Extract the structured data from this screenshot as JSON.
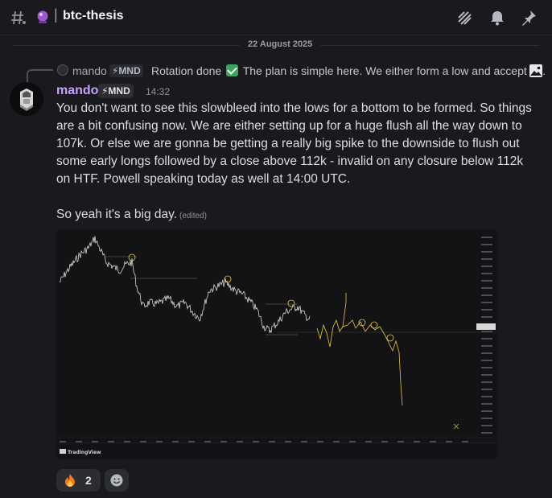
{
  "header": {
    "separator": "|",
    "channel_name": "btc-thesis"
  },
  "divider": {
    "date": "22 August 2025"
  },
  "reply": {
    "author": "mando",
    "role_tag": "⚡MND",
    "text_before": "Rotation done",
    "text_after": "The plan is simple here. We either form a low and accept b..."
  },
  "message": {
    "author": "mando",
    "role_tag": "⚡MND",
    "timestamp": "14:32",
    "body": "You don't want to see this slowbleed into the lows for a bottom to be formed. So things are a bit confusing now. We are either setting up for a huge flush all the way down to 107k. Or else we are gonna be getting a really big spike to the downside to flush out some early longs followed by a close above 112k - invalid on any closure below 112k on HTF. Powell speaking today as well at 14:00 UTC.",
    "line2": "So yeah it's a big day.",
    "edited": "(edited)"
  },
  "chart_image": {
    "watermark": "TradingView"
  },
  "reactions": [
    {
      "emoji": "fire-emoji",
      "count": "2"
    }
  ],
  "colors": {
    "background": "#1a1a1e",
    "author": "#c9a0ff",
    "chart_path": "#d8d8d8",
    "chart_projection": "#e6c84a"
  }
}
